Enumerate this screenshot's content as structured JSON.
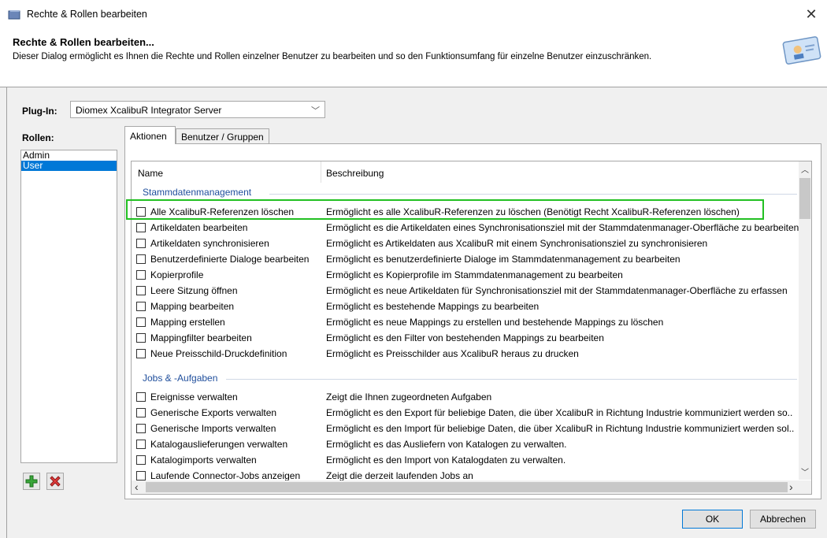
{
  "window": {
    "title": "Rechte & Rollen bearbeiten"
  },
  "header": {
    "title": "Rechte & Rollen bearbeiten...",
    "description": "Dieser Dialog ermöglicht es Ihnen die Rechte und Rollen einzelner Benutzer zu bearbeiten und so den Funktionsumfang für einzelne Benutzer einzuschränken."
  },
  "plugin": {
    "label": "Plug-In:",
    "selected": "Diomex XcalibuR Integrator Server"
  },
  "roles": {
    "label": "Rollen:",
    "items": [
      "Admin",
      "User"
    ],
    "selected": "User"
  },
  "tabs": [
    "Aktionen",
    "Benutzer / Gruppen"
  ],
  "table": {
    "columns": {
      "name": "Name",
      "description": "Beschreibung"
    },
    "groups": [
      {
        "title": "Stammdatenmanagement",
        "rows": [
          {
            "name": "Alle XcalibuR-Referenzen löschen",
            "desc": "Ermöglicht es alle XcalibuR-Referenzen zu löschen (Benötigt Recht XcalibuR-Referenzen löschen)"
          },
          {
            "name": "Artikeldaten bearbeiten",
            "desc": "Ermöglicht es die Artikeldaten eines Synchronisationsziel mit der Stammdatenmanager-Oberfläche zu bearbeiten"
          },
          {
            "name": "Artikeldaten synchronisieren",
            "desc": "Ermöglicht es Artikeldaten aus XcalibuR mit einem Synchronisationsziel zu synchronisieren"
          },
          {
            "name": "Benutzerdefinierte Dialoge bearbeiten",
            "desc": "Ermöglicht es benutzerdefinierte Dialoge im Stammdatenmanagement zu bearbeiten"
          },
          {
            "name": "Kopierprofile",
            "desc": "Ermöglicht es Kopierprofile im Stammdatenmanagement zu bearbeiten"
          },
          {
            "name": "Leere Sitzung öffnen",
            "desc": "Ermöglicht es neue Artikeldaten für Synchronisationsziel mit der Stammdatenmanager-Oberfläche zu erfassen"
          },
          {
            "name": "Mapping bearbeiten",
            "desc": "Ermöglicht es bestehende Mappings zu bearbeiten"
          },
          {
            "name": "Mapping erstellen",
            "desc": "Ermöglicht es neue Mappings zu erstellen und bestehende Mappings zu löschen"
          },
          {
            "name": "Mappingfilter bearbeiten",
            "desc": "Ermöglicht es den Filter von bestehenden Mappings zu bearbeiten"
          },
          {
            "name": "Neue Preisschild-Druckdefinition",
            "desc": "Ermöglicht es Preisschilder aus XcalibuR heraus zu drucken"
          }
        ]
      },
      {
        "title": "Jobs & -Aufgaben",
        "rows": [
          {
            "name": "Ereignisse verwalten",
            "desc": "Zeigt die Ihnen zugeordneten Aufgaben"
          },
          {
            "name": "Generische Exports verwalten",
            "desc": "Ermöglicht es den Export für beliebige Daten, die über XcalibuR in Richtung Industrie kommuniziert werden so.."
          },
          {
            "name": "Generische Imports verwalten",
            "desc": "Ermöglicht es den Import für beliebige Daten, die über XcalibuR in Richtung Industrie kommuniziert werden sol.."
          },
          {
            "name": "Katalogauslieferungen verwalten",
            "desc": "Ermöglicht es das Ausliefern von Katalogen zu verwalten."
          },
          {
            "name": "Katalogimports verwalten",
            "desc": "Ermöglicht es den Import von Katalogdaten zu verwalten."
          },
          {
            "name": "Laufende Connector-Jobs anzeigen",
            "desc": "Zeigt die derzeit laufenden Jobs an"
          }
        ]
      }
    ]
  },
  "buttons": {
    "ok": "OK",
    "cancel": "Abbrechen",
    "add_icon": "add-icon",
    "delete_icon": "delete-icon"
  }
}
